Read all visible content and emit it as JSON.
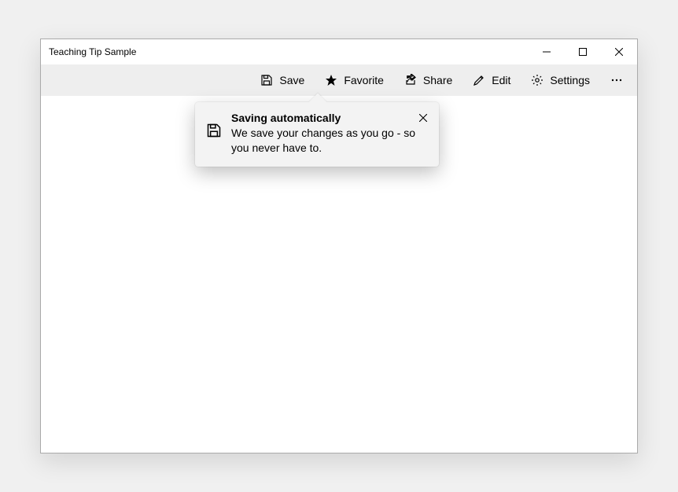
{
  "window": {
    "title": "Teaching Tip Sample"
  },
  "toolbar": {
    "save_label": "Save",
    "favorite_label": "Favorite",
    "share_label": "Share",
    "edit_label": "Edit",
    "settings_label": "Settings"
  },
  "teaching_tip": {
    "title": "Saving automatically",
    "body": "We save your changes as you go - so you never have to."
  }
}
